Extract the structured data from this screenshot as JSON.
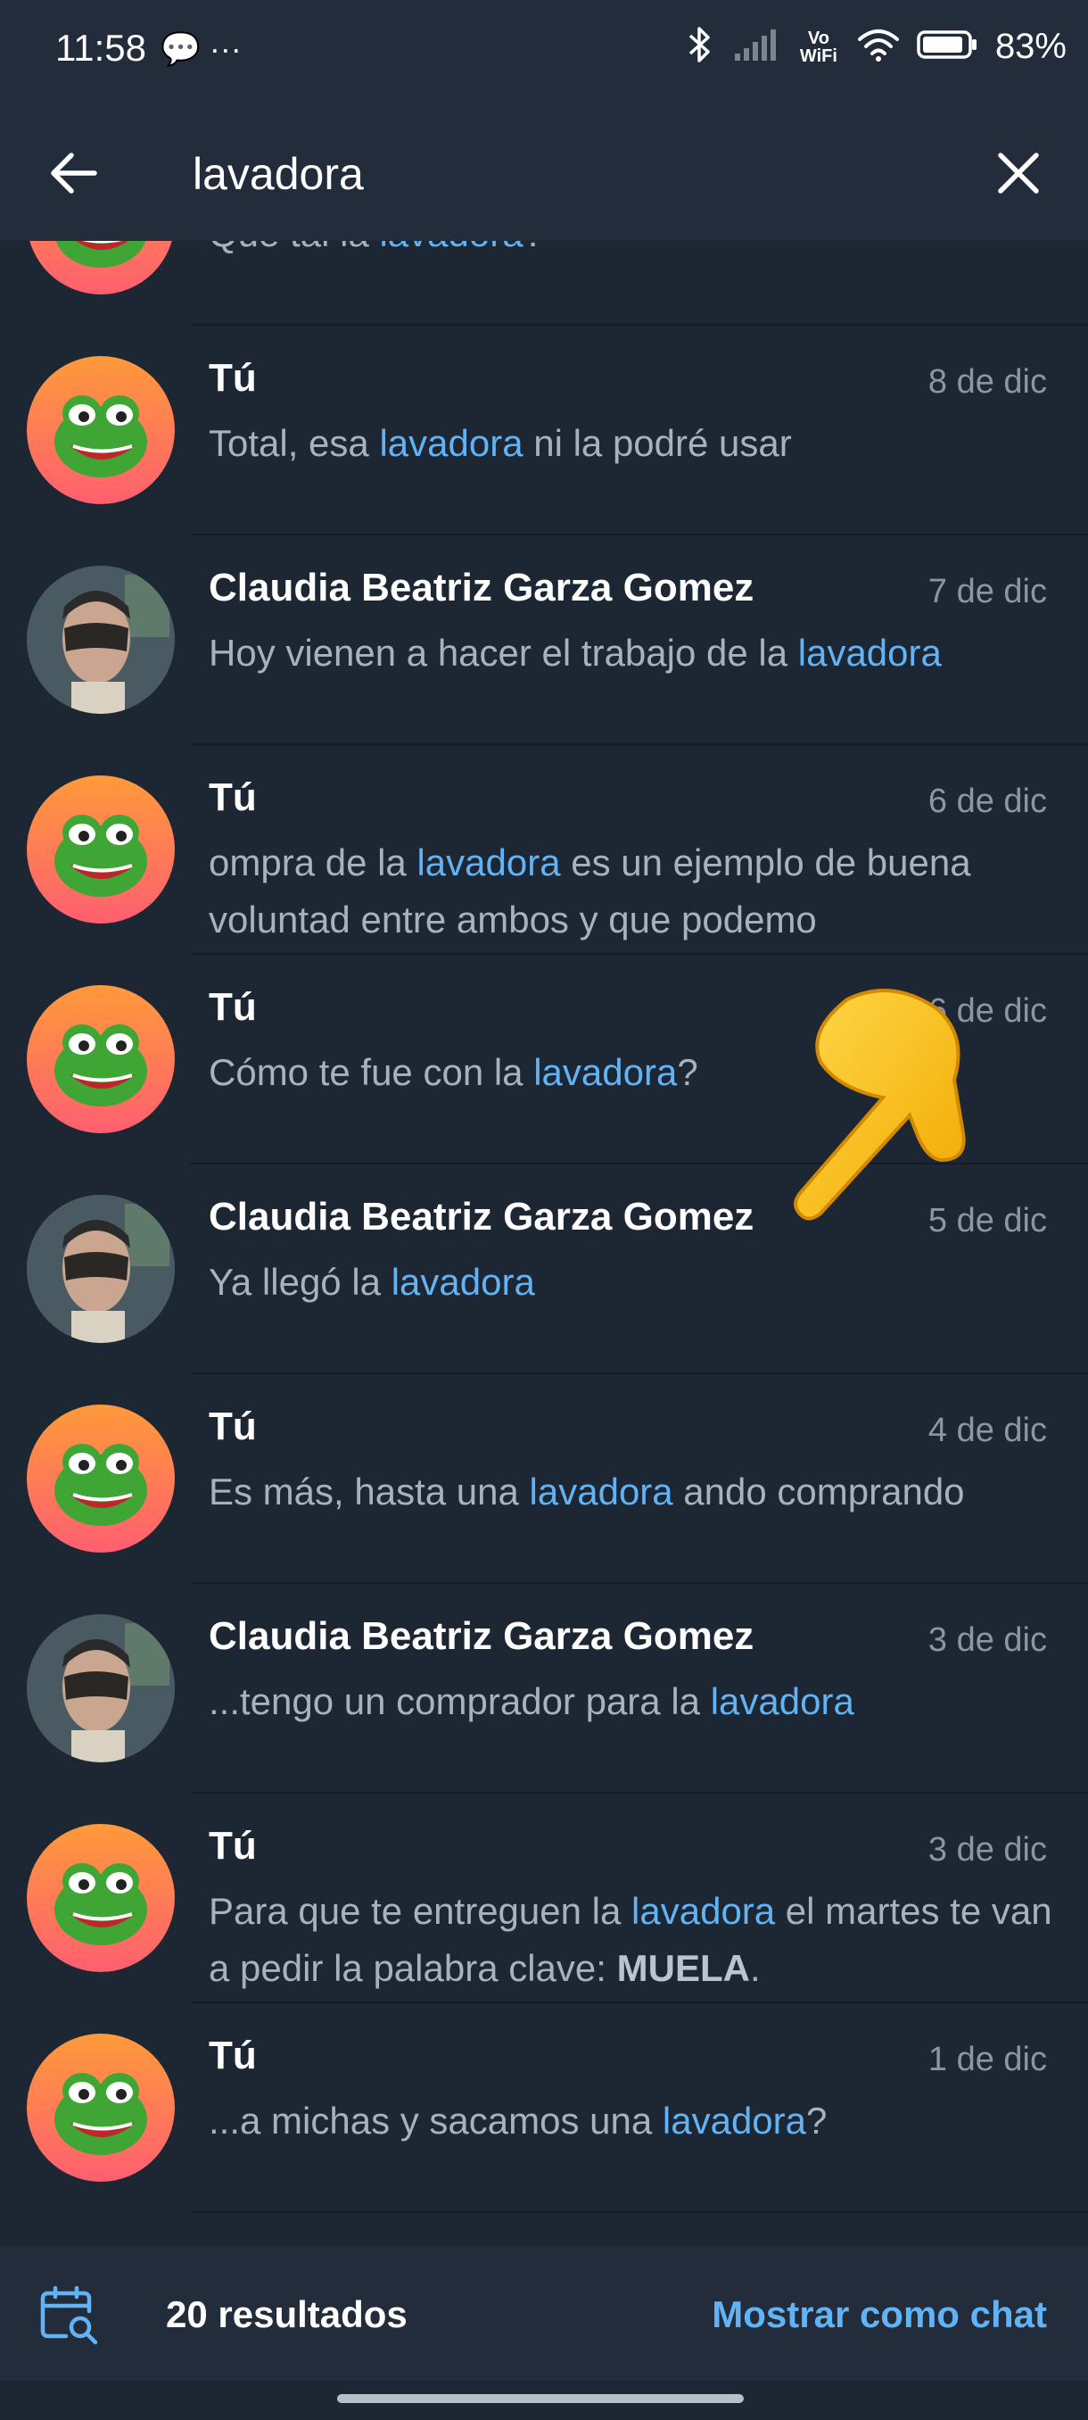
{
  "status_bar": {
    "time": "11:58",
    "left_icons": "💬 ···",
    "network": "Vo WiFi",
    "battery": "83%"
  },
  "header": {
    "search_value": "lavadora",
    "back_icon": "arrow-left-icon",
    "clear_icon": "close-icon"
  },
  "results": [
    {
      "sender": "",
      "date": "",
      "avatar": "frog",
      "parts": [
        {
          "t": "Que tal la "
        },
        {
          "t": "lavadora",
          "h": true
        },
        {
          "t": "?"
        }
      ]
    },
    {
      "sender": "Tú",
      "date": "8 de dic",
      "avatar": "frog",
      "parts": [
        {
          "t": "Total, esa "
        },
        {
          "t": "lavadora",
          "h": true
        },
        {
          "t": " ni la podré usar"
        }
      ]
    },
    {
      "sender": "Claudia Beatriz Garza Gomez",
      "date": "7 de dic",
      "avatar": "photo",
      "parts": [
        {
          "t": "Hoy vienen a hacer el trabajo de la "
        },
        {
          "t": "lavadora",
          "h": true
        }
      ]
    },
    {
      "sender": "Tú",
      "date": "6 de dic",
      "avatar": "frog",
      "parts": [
        {
          "t": "ompra de la "
        },
        {
          "t": "lavadora",
          "h": true
        },
        {
          "t": " es un ejemplo de buena voluntad entre ambos y que podemo"
        }
      ]
    },
    {
      "sender": "Tú",
      "date": "6 de dic",
      "avatar": "frog",
      "parts": [
        {
          "t": "Cómo te fue con la "
        },
        {
          "t": "lavadora",
          "h": true
        },
        {
          "t": "?"
        }
      ]
    },
    {
      "sender": "Claudia Beatriz Garza Gomez",
      "date": "5 de dic",
      "avatar": "photo",
      "parts": [
        {
          "t": "Ya llegó la "
        },
        {
          "t": "lavadora",
          "h": true
        }
      ]
    },
    {
      "sender": "Tú",
      "date": "4 de dic",
      "avatar": "frog",
      "parts": [
        {
          "t": "Es más, hasta una "
        },
        {
          "t": "lavadora",
          "h": true
        },
        {
          "t": " ando comprando"
        }
      ]
    },
    {
      "sender": "Claudia Beatriz Garza Gomez",
      "date": "3 de dic",
      "avatar": "photo",
      "parts": [
        {
          "t": "...tengo un comprador para la "
        },
        {
          "t": "lavadora",
          "h": true
        }
      ]
    },
    {
      "sender": "Tú",
      "date": "3 de dic",
      "avatar": "frog",
      "parts": [
        {
          "t": "Para que te entreguen la "
        },
        {
          "t": "lavadora",
          "h": true
        },
        {
          "t": " el martes te van a pedir la palabra clave: "
        },
        {
          "t": "MUELA",
          "b": true
        },
        {
          "t": "."
        }
      ]
    },
    {
      "sender": "Tú",
      "date": "1 de dic",
      "avatar": "frog",
      "parts": [
        {
          "t": "...a michas y sacamos una "
        },
        {
          "t": "lavadora",
          "h": true
        },
        {
          "t": "?"
        }
      ]
    }
  ],
  "bottom_bar": {
    "results_count": "20 resultados",
    "show_as_chat": "Mostrar como chat",
    "calendar_icon": "calendar-search-icon"
  },
  "colors": {
    "background": "#1d2633",
    "bar": "#222c3a",
    "accent": "#62b3f5",
    "muted_text": "#a7b2bf"
  }
}
